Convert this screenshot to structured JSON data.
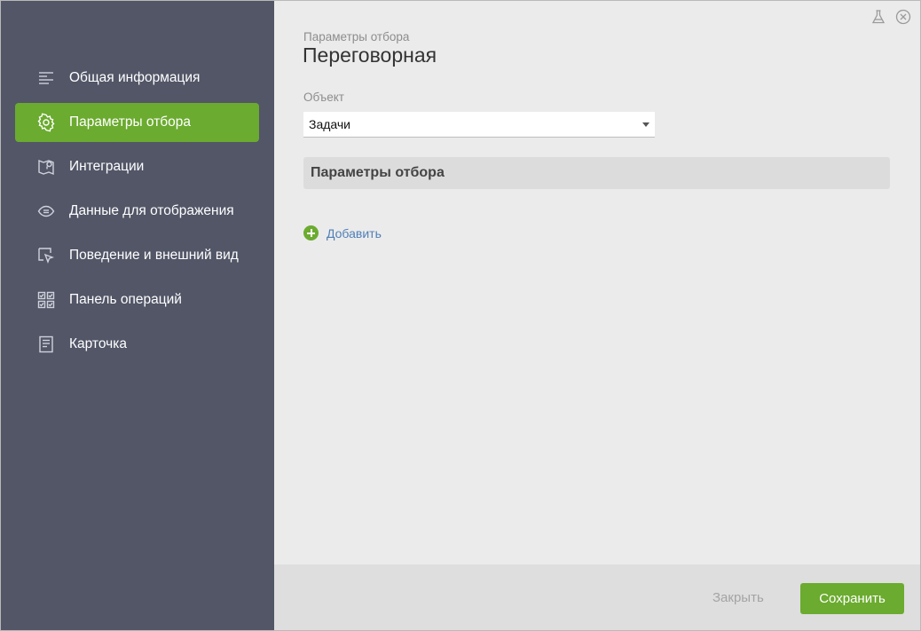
{
  "sidebar": {
    "items": [
      {
        "label": "Общая информация",
        "icon": "lines-icon",
        "active": false
      },
      {
        "label": "Параметры отбора",
        "icon": "gear-icon",
        "active": true
      },
      {
        "label": "Интеграции",
        "icon": "map-pin-icon",
        "active": false
      },
      {
        "label": "Данные для отображения",
        "icon": "eye-icon",
        "active": false
      },
      {
        "label": "Поведение и внешний вид",
        "icon": "cursor-icon",
        "active": false
      },
      {
        "label": "Панель операций",
        "icon": "checklist-grid-icon",
        "active": false
      },
      {
        "label": "Карточка",
        "icon": "card-icon",
        "active": false
      }
    ]
  },
  "main": {
    "subtitle": "Параметры отбора",
    "title": "Переговорная",
    "object_label": "Объект",
    "object_value": "Задачи",
    "section_title": "Параметры отбора",
    "add_label": "Добавить"
  },
  "footer": {
    "close_label": "Закрыть",
    "save_label": "Сохранить"
  },
  "top_icons": [
    "flask-icon",
    "close-circle-icon"
  ],
  "colors": {
    "sidebar_bg": "#525667",
    "accent": "#6bab2f",
    "link": "#4f7fb8"
  }
}
